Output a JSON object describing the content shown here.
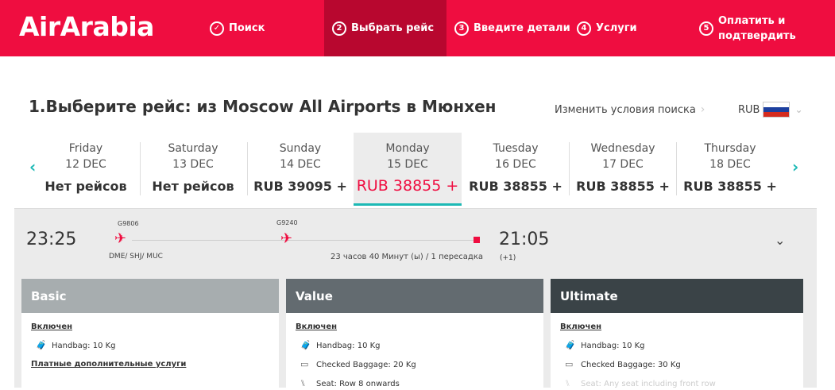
{
  "header": {
    "logo": "AirArabia",
    "steps": [
      {
        "num": "✓",
        "label": "Поиск"
      },
      {
        "num": "2",
        "label": "Выбрать рейс"
      },
      {
        "num": "3",
        "label": "Введите детали"
      },
      {
        "num": "4",
        "label": "Услуги"
      },
      {
        "num": "5",
        "label_line1": "Оплатить и",
        "label_line2": "подтвердить"
      }
    ]
  },
  "search": {
    "title": "1.Выберите рейс: из Moscow All Airports в Мюнхен",
    "modify_label": "Изменить условия поиска",
    "currency": "RUB"
  },
  "dates": [
    {
      "weekday": "Friday",
      "date": "12 DEC",
      "price": "Нет рейсов"
    },
    {
      "weekday": "Saturday",
      "date": "13 DEC",
      "price": "Нет рейсов"
    },
    {
      "weekday": "Sunday",
      "date": "14 DEC",
      "price": "RUB 39095 +"
    },
    {
      "weekday": "Monday",
      "date": "15 DEC",
      "price": "RUB 38855 +"
    },
    {
      "weekday": "Tuesday",
      "date": "16 DEC",
      "price": "RUB 38855 +"
    },
    {
      "weekday": "Wednesday",
      "date": "17 DEC",
      "price": "RUB 38855 +"
    },
    {
      "weekday": "Thursday",
      "date": "18 DEC",
      "price": "RUB 38855 +"
    }
  ],
  "flight": {
    "departure": "23:25",
    "arrival": "21:05",
    "arrival_offset": "(+1)",
    "flight1": "G9806",
    "flight2": "G9240",
    "airports": "DME/ SHJ/ MUC",
    "duration": "23 часов 40 Минут (ы) / 1 пересадка"
  },
  "fares": [
    {
      "name": "Basic",
      "color": "#a7adaf",
      "included_label": "Включен",
      "features": [
        "Handbag: 10 Kg"
      ],
      "extras_label": "Платные дополнительные услуги"
    },
    {
      "name": "Value",
      "color": "#636b70",
      "included_label": "Включен",
      "features": [
        "Handbag: 10 Kg",
        "Checked Baggage: 20 Kg",
        "Seat: Row 8 onwards"
      ]
    },
    {
      "name": "Ultimate",
      "color": "#3a4347",
      "included_label": "Включен",
      "features": [
        "Handbag: 10 Kg",
        "Checked Baggage: 30 Kg",
        "Seat: Any seat including front row"
      ]
    }
  ],
  "colors": {
    "brand": "#ef0d40",
    "brand_dark": "#b8072f",
    "accent": "#1cb9b5"
  }
}
